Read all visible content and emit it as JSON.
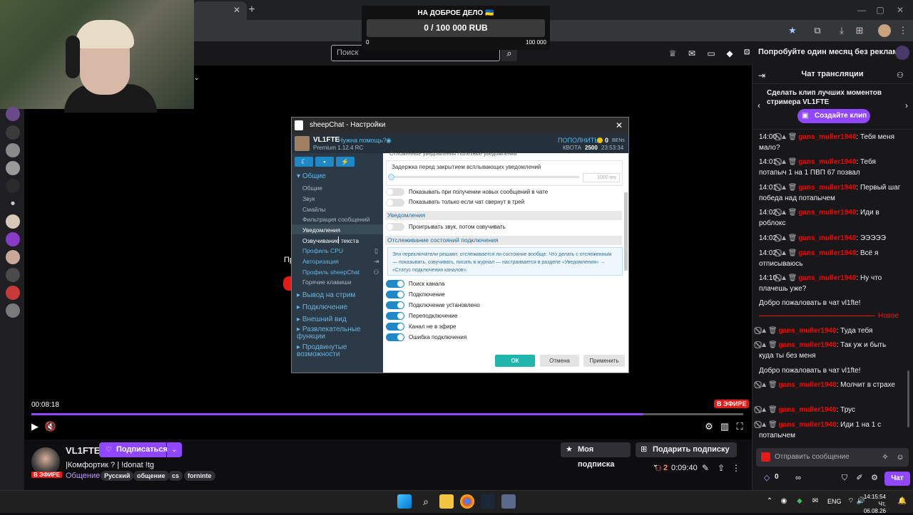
{
  "browser": {
    "tab_close": "✕",
    "new_tab": "+",
    "window_controls": [
      "—",
      "▢",
      "✕"
    ]
  },
  "donation": {
    "title": "НА ДОБРОЕ ДЕЛО 🇺🇦",
    "progress_text": "0 / 100 000 RUB",
    "progress_fraction": 0,
    "min_label": "0",
    "max_label": "100 000"
  },
  "topbar": {
    "search_placeholder": "Поиск",
    "promo": "Попробуйте один месяц без рекламы"
  },
  "player": {
    "time": "00:08:18",
    "live_badge": "В ЭФИРЕ",
    "progress_fraction": 0.86,
    "bg_text": "Пр"
  },
  "channel": {
    "name": "VL1FTE",
    "live_badge": "В ЭФИРЕ",
    "follow_label": "Подписаться",
    "title": "|Комфортик ? | !donat !tg",
    "category": "Общение",
    "tags": [
      "Русский",
      "общение",
      "cs",
      "forninte"
    ],
    "my_sub_label": "Моя подписка",
    "gift_label": "Подарить подписку",
    "viewers": "2",
    "uptime": "0:09:40"
  },
  "chat": {
    "title": "Чат трансляции",
    "clip_prompt": "Сделать клип лучших моментов стримера VL1FTE",
    "clip_button": "Создайте клип",
    "messages": [
      {
        "time": "14:00",
        "user": "gans_muller1940",
        "text": ": Тебя меня мало?"
      },
      {
        "time": "14:01",
        "user": "gans_muller1940",
        "text": ": Тебя потапыч 1 на 1 ПВП 67 позвал"
      },
      {
        "time": "14:01",
        "user": "gans_muller1940",
        "text": ": Первый шаг победа над потапычем"
      },
      {
        "time": "14:02",
        "user": "gans_muller1940",
        "text": ": Иди в роблокс"
      },
      {
        "time": "14:02",
        "user": "gans_muller1940",
        "text": ": ЭЭЭЭЭ"
      },
      {
        "time": "14:02",
        "user": "gans_muller1940",
        "text": ": Всё я отписываюсь"
      },
      {
        "time": "14:10",
        "user": "gans_muller1940",
        "text": ": Ну что плачешь уже?"
      }
    ],
    "welcome1": "Добро пожаловать в чат vl1fte!",
    "new_label": "Новое",
    "messages2": [
      {
        "user": "gans_muller1940",
        "text": ": Туда тебя"
      },
      {
        "user": "gans_muller1940",
        "text": ": Так уж и быть куда ты без меня"
      }
    ],
    "welcome2": "Добро пожаловать в чат vl1fte!",
    "messages3": [
      {
        "user": "gans_muller1940",
        "text": ": Молчит в страхе"
      },
      {
        "user": "gans_muller1940",
        "text": ": Трус"
      },
      {
        "user": "gans_muller1940",
        "text": ": Иди 1 на 1 с потапычем"
      }
    ],
    "mod_icons": "⃠⃠▲🗑",
    "input_placeholder": "Отправить сообщение",
    "points": "0",
    "send_label": "Чат"
  },
  "dialog": {
    "title": "sheepChat - Настройки",
    "user": "VL1FTE",
    "help": "Нужна помощь?",
    "version": "Premium 1.12.4 RC",
    "topup": "ПОПОЛНИТЬ",
    "balance": "0",
    "balance_unit": "BENs",
    "quota_label": "КВОТА",
    "quota_value": "2500",
    "clock": "23:53:34",
    "sections": {
      "general": "Общие",
      "output": "Вывод на стрим",
      "connection": "Подключение",
      "appearance": "Внешний вид",
      "entertainment": "Развлекательные функции",
      "advanced": "Продвинутые возможности"
    },
    "sub_items": [
      "Общие",
      "Звук",
      "Смайлы",
      "Фильтрация сообщений",
      "Уведомления",
      "Озвучивание текста",
      "Профиль CPU",
      "Авторизация",
      "Профиль sheepChat",
      "Горячие клавиши"
    ],
    "cut_top": "Отложенные уведомления   Полезные уведомления",
    "delay_label": "Задержка перед закрытием всплывающих уведомлений",
    "delay_value": "1000 ms",
    "opt_show_new": "Показывать при получении новых сообщений в чате",
    "opt_show_tray": "Показывать только если чат свернут в трей",
    "grp_notifications": "Уведомления",
    "opt_play_sound": "Проигрывать звук, потом озвучивать",
    "grp_tracking": "Отслеживание состояний подключения",
    "info": "Эти переключатели решают, отслеживается ли состояние вообще. Что делать с отслеженным — показывать, озвучивать, писать в журнал — настраивается в разделе «Уведомления» → «Статус подключения каналов».",
    "toggles": [
      "Поиск канала",
      "Подключение",
      "Подключение установлено",
      "Переподключение",
      "Канал не в эфире",
      "Ошибка подключения"
    ],
    "ok": "ОК",
    "cancel": "Отмена",
    "apply": "Применить"
  },
  "taskbar": {
    "lang": "ENG",
    "time": "14:15:54",
    "date": "Чт, 06.08.26"
  }
}
